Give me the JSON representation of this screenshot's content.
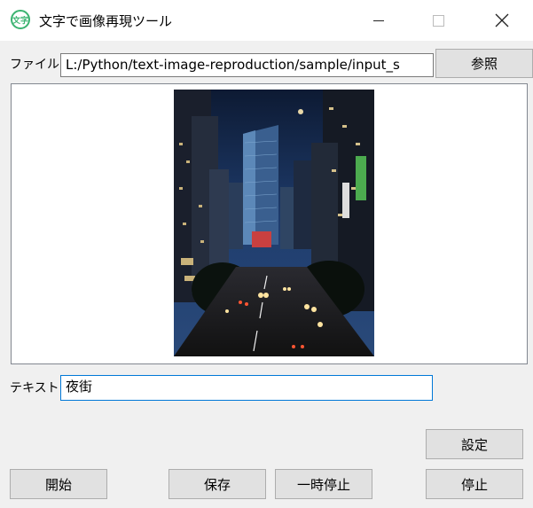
{
  "window": {
    "icon_text": "文字",
    "title": "文字で画像再現ツール"
  },
  "file_row": {
    "label": "ファイル",
    "path_value": "L:/Python/text-image-reproduction/sample/input_s",
    "browse_label": "参照"
  },
  "image": {
    "description_icon": "city-night-street-photo"
  },
  "text_row": {
    "label": "テキスト",
    "value": "夜街"
  },
  "buttons": {
    "settings": "設定",
    "start": "開始",
    "save": "保存",
    "pause": "一時停止",
    "stop": "停止"
  }
}
